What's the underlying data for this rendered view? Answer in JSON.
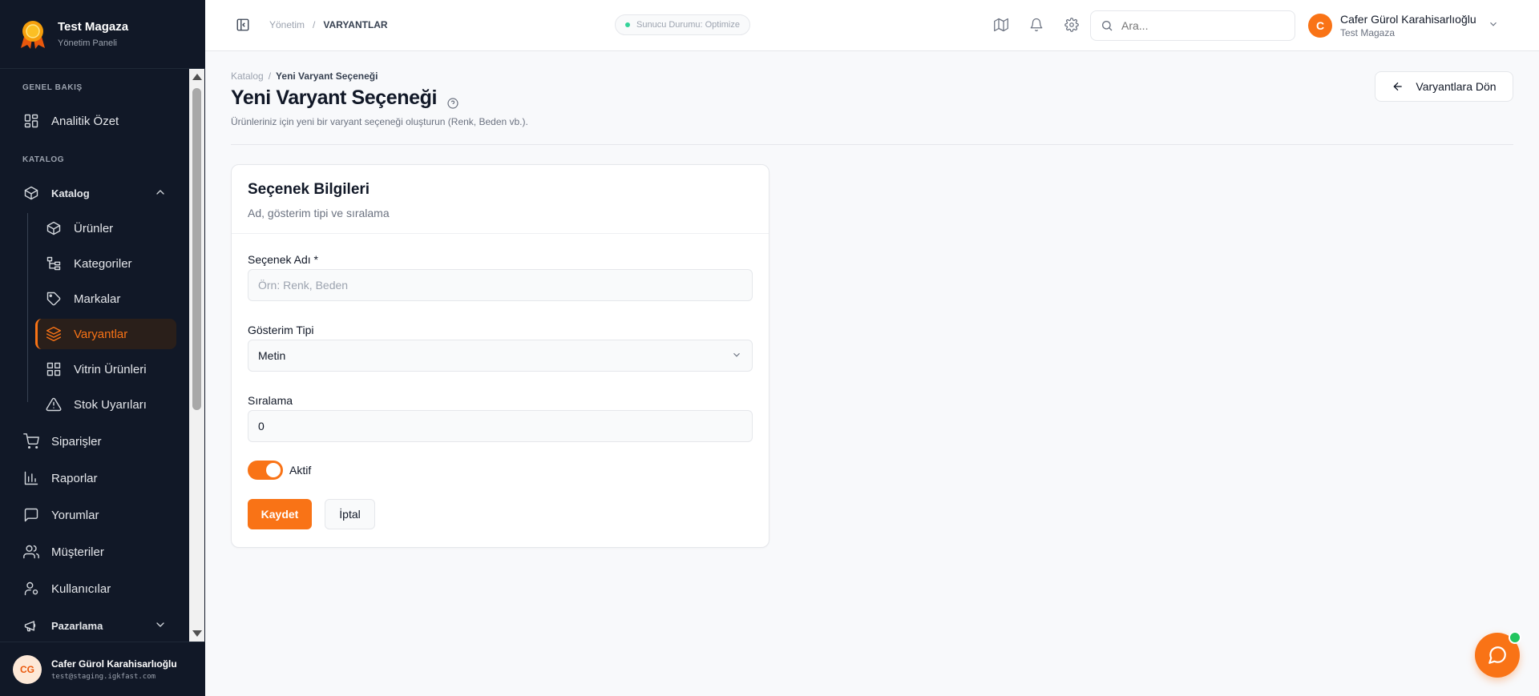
{
  "brand": {
    "name": "Test Magaza",
    "subtitle": "Yönetim Paneli"
  },
  "sidebar": {
    "sections": [
      {
        "label": "GENEL BAKIŞ"
      },
      {
        "label": "KATALOG"
      }
    ],
    "items": [
      {
        "label": "Analitik Özet",
        "icon": "dashboard-icon"
      },
      {
        "label": "Katalog",
        "icon": "box-icon"
      },
      {
        "label": "Ürünler",
        "icon": "box-icon"
      },
      {
        "label": "Kategoriler",
        "icon": "tree-icon"
      },
      {
        "label": "Markalar",
        "icon": "tag-icon"
      },
      {
        "label": "Varyantlar",
        "icon": "layers-icon",
        "active": true
      },
      {
        "label": "Vitrin Ürünleri",
        "icon": "grid-icon"
      },
      {
        "label": "Stok Uyarıları",
        "icon": "warning-icon"
      },
      {
        "label": "Siparişler",
        "icon": "cart-icon"
      },
      {
        "label": "Raporlar",
        "icon": "chart-icon"
      },
      {
        "label": "Yorumlar",
        "icon": "comment-icon"
      },
      {
        "label": "Müşteriler",
        "icon": "users-icon"
      },
      {
        "label": "Kullanıcılar",
        "icon": "user-gear-icon"
      },
      {
        "label": "Pazarlama",
        "icon": "megaphone-icon"
      }
    ],
    "user": {
      "initials": "CG",
      "name": "Cafer Gürol Karahisarlıoğlu",
      "email": "test@staging.igkfast.com"
    }
  },
  "topbar": {
    "breadcrumb": {
      "parent": "Yönetim",
      "separator": "/",
      "current": "VARYANTLAR"
    },
    "status": "Sunucu Durumu: Optimize",
    "search_placeholder": "Ara...",
    "profile": {
      "initial": "C",
      "name": "Cafer Gürol Karahisarlıoğlu",
      "store": "Test Magaza"
    }
  },
  "page": {
    "breadcrumb": {
      "parent": "Katalog",
      "separator": "/",
      "current": "Yeni Varyant Seçeneği"
    },
    "title": "Yeni Varyant Seçeneği",
    "description": "Ürünleriniz için yeni bir varyant seçeneği oluşturun (Renk, Beden vb.).",
    "back_button": "Varyantlara Dön"
  },
  "form": {
    "title": "Seçenek Bilgileri",
    "subtitle": "Ad, gösterim tipi ve sıralama",
    "name_label": "Seçenek Adı *",
    "name_value": "",
    "name_placeholder": "Örn: Renk, Beden",
    "display_type_label": "Gösterim Tipi",
    "display_type_value": "Metin",
    "order_label": "Sıralama",
    "order_value": "0",
    "active_label": "Aktif",
    "active": true,
    "save_label": "Kaydet",
    "cancel_label": "İptal"
  },
  "colors": {
    "accent": "#f97316",
    "sidebar_bg": "#111827",
    "status_dot": "#34d399"
  }
}
